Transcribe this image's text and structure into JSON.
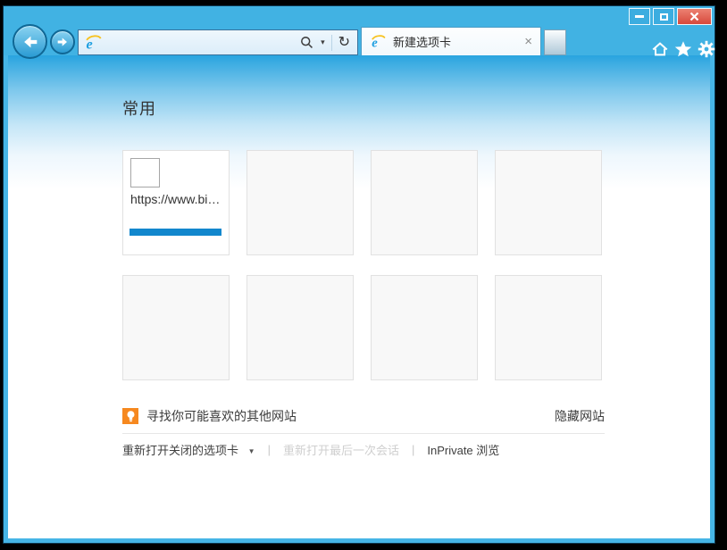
{
  "window": {
    "app": "Internet Explorer"
  },
  "navbar": {
    "address": {
      "value": "",
      "placeholder": ""
    },
    "search_caret": "▾",
    "refresh_glyph": "↻",
    "tab": {
      "title": "新建选项卡",
      "close_glyph": "×"
    }
  },
  "icons": {
    "back": "arrow-left-circle",
    "forward": "arrow-right-circle",
    "ie_logo": "ie-e-with-ring",
    "search": "magnifier",
    "refresh": "circular-arrow",
    "new_tab": "blank-tab",
    "home": "house",
    "favorites": "star",
    "tools": "gear",
    "suggest": "lightbulb",
    "minimize": "dash",
    "maximize": "square",
    "close": "x"
  },
  "page": {
    "heading": "常用",
    "tiles": [
      {
        "url": "https://www.bi…",
        "has_thumbnail": true
      },
      {
        "url": ""
      },
      {
        "url": ""
      },
      {
        "url": ""
      },
      {
        "url": ""
      },
      {
        "url": ""
      },
      {
        "url": ""
      },
      {
        "url": ""
      }
    ],
    "suggest_label": "寻找你可能喜欢的其他网站",
    "hide_label": "隐藏网站",
    "links": {
      "reopen_closed": "重新打开关闭的选项卡",
      "caret": "▼",
      "sep": "|",
      "reopen_session": "重新打开最后一次会话",
      "inprivate": "InPrivate 浏览"
    }
  },
  "colors": {
    "frame_blue": "#41b2e3",
    "content_gradient_top": "#29a4df",
    "tile_bar_blue": "#1287cd",
    "suggest_orange": "#f6881f",
    "close_button_red": "#d7493c"
  }
}
